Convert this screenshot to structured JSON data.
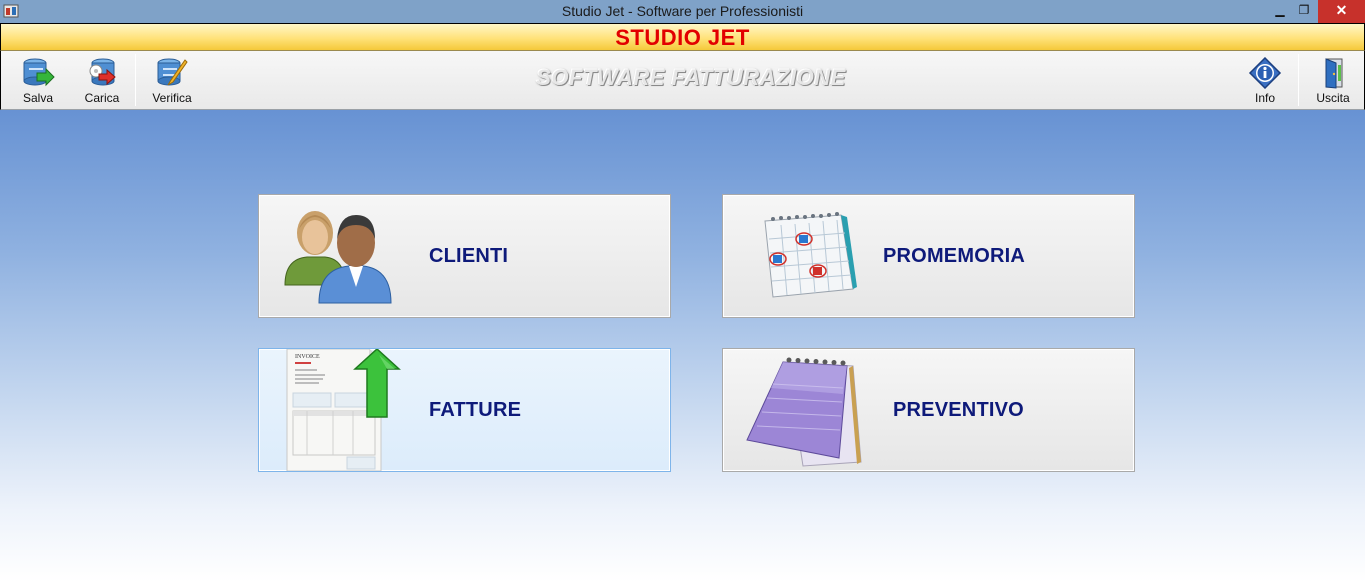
{
  "window": {
    "title": "Studio Jet - Software per Professionisti",
    "minimize_glyph": "▁",
    "restore_glyph": "❐",
    "close_glyph": "✕"
  },
  "header": {
    "brand": "STUDIO JET",
    "brand_color": "#e20000"
  },
  "toolbar": {
    "subtitle": "SOFTWARE FATTURAZIONE",
    "buttons": [
      {
        "label": "Salva",
        "icon": "database-save-icon"
      },
      {
        "label": "Carica",
        "icon": "database-load-icon"
      },
      {
        "label": "Verifica",
        "icon": "database-check-icon"
      },
      {
        "label": "Info",
        "icon": "info-icon"
      },
      {
        "label": "Uscita",
        "icon": "exit-door-icon"
      }
    ]
  },
  "tiles": [
    {
      "label": "CLIENTI",
      "icon": "users-icon"
    },
    {
      "label": "PROMEMORIA",
      "icon": "calendar-icon"
    },
    {
      "label": "FATTURE",
      "icon": "invoice-icon",
      "invoice_heading": "INVOICE"
    },
    {
      "label": "PREVENTIVO",
      "icon": "notepad-icon"
    }
  ],
  "colors": {
    "tile_label": "#0e1a7a",
    "close_button": "#c7312b"
  }
}
